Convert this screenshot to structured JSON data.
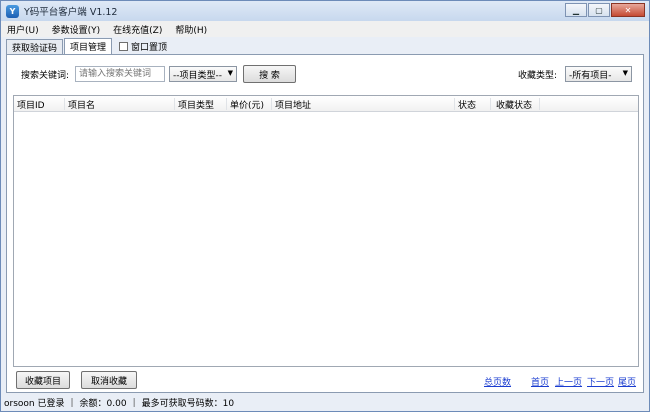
{
  "window": {
    "title": "Y码平台客户端 V1.12",
    "icon_glyph": "Y",
    "controls": {
      "minimize": "▁",
      "maximize": "▢",
      "close": "✕"
    }
  },
  "menu": [
    "用户(U)",
    "参数设置(Y)",
    "在线充值(Z)",
    "帮助(H)"
  ],
  "tabs": [
    {
      "label": "获取验证码",
      "active": false
    },
    {
      "label": "项目管理",
      "active": true
    }
  ],
  "topmost_checkbox": {
    "label": "窗口置顶",
    "checked": false
  },
  "search": {
    "keyword_label": "搜索关键词:",
    "keyword_placeholder": "请输入搜索关键词",
    "keyword_value": "",
    "project_type_value": "--项目类型--",
    "search_button": "搜  索",
    "favorite_type_label": "收藏类型:",
    "favorite_type_value": "-所有项目-"
  },
  "table": {
    "columns": [
      "项目ID",
      "项目名",
      "项目类型",
      "单价(元)",
      "项目地址",
      "状态",
      "收藏状态"
    ],
    "rows": []
  },
  "actions": {
    "favorite_button": "收藏项目",
    "unfavorite_button": "取消收藏"
  },
  "pager": {
    "total_pages": "总页数",
    "first_page": "首页",
    "prev_page": "上一页",
    "next_page": "下一页",
    "last_page": "尾页"
  },
  "status": {
    "user": "orsoon 已登录",
    "balance": "余额：0.00",
    "max_numbers": "最多可获取号码数：10"
  },
  "colors": {
    "link": "#1a3cd0",
    "close_button": "#c54a33",
    "titlebar": "#c7d8ee"
  },
  "icons": {
    "app": "y-logo-icon",
    "checkbox": "checkbox-icon",
    "dropdown": "chevron-down-icon"
  }
}
